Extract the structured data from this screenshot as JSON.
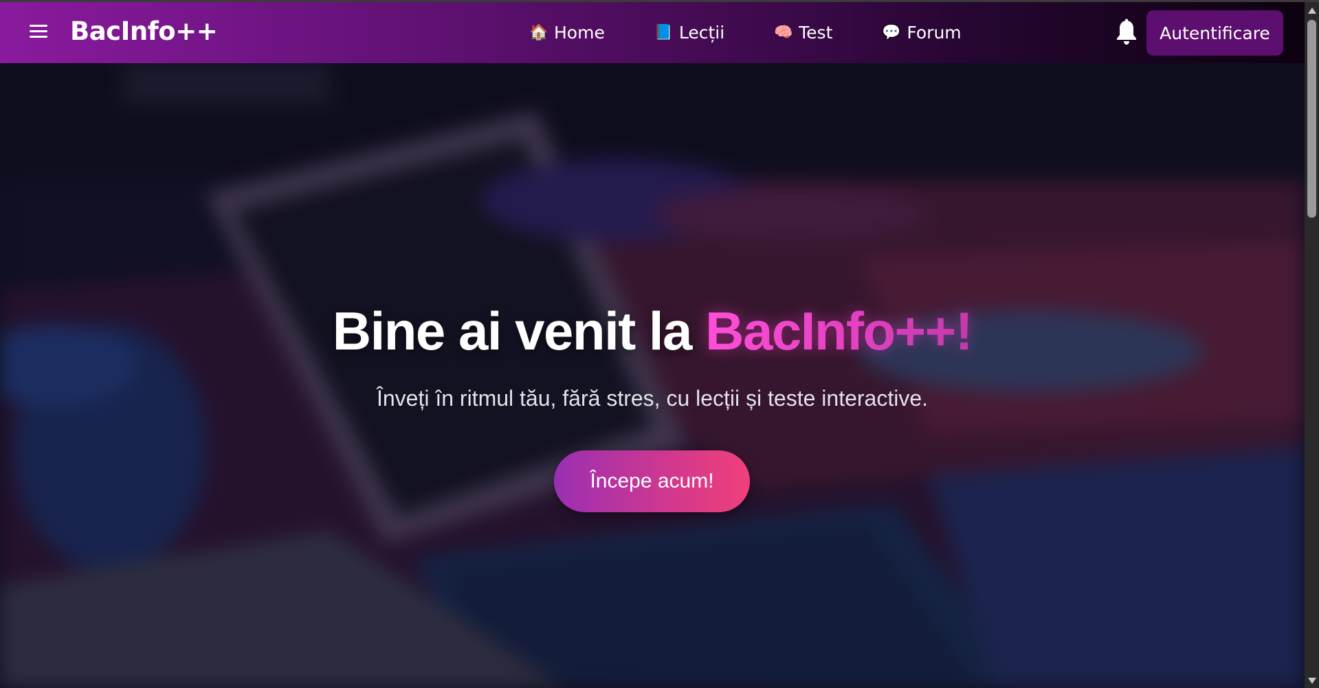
{
  "navbar": {
    "brand": "BacInfo++",
    "links": [
      {
        "emoji": "🏠",
        "label": "Home"
      },
      {
        "emoji": "📘",
        "label": "Lecții"
      },
      {
        "emoji": "🧠",
        "label": "Test"
      },
      {
        "emoji": "💬",
        "label": "Forum"
      }
    ],
    "auth_button": "Autentificare"
  },
  "hero": {
    "title_prefix": "Bine ai venit la ",
    "title_accent": "BacInfo++!",
    "subtitle": "Înveți în ritmul tău, fără stres, cu lecții și teste interactive.",
    "cta_label": "Începe acum!"
  },
  "colors": {
    "navbar_start": "#8a1a9e",
    "navbar_end": "#0d0210",
    "auth_button_bg": "#5c0f6e",
    "accent_pink": "#ff4fd8",
    "cta_start": "#9a2fb2",
    "cta_end": "#f0407a"
  },
  "icons": {
    "menu": "hamburger-icon",
    "notifications": "bell-icon"
  }
}
